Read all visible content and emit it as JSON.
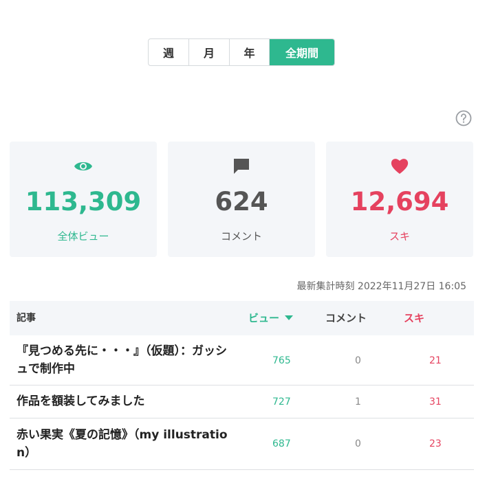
{
  "tabs": [
    {
      "label": "週",
      "active": false
    },
    {
      "label": "月",
      "active": false
    },
    {
      "label": "年",
      "active": false
    },
    {
      "label": "全期間",
      "active": true
    }
  ],
  "stats": {
    "views": {
      "value": "113,309",
      "label": "全体ビュー",
      "icon": "eye-icon"
    },
    "comments": {
      "value": "624",
      "label": "コメント",
      "icon": "comment-icon"
    },
    "likes": {
      "value": "12,694",
      "label": "スキ",
      "icon": "heart-icon"
    }
  },
  "updated": "最新集計時刻 2022年11月27日 16:05",
  "table": {
    "headers": {
      "article": "記事",
      "views": "ビュー",
      "comments": "コメント",
      "likes": "スキ"
    },
    "rows": [
      {
        "title": "『見つめる先に・・・』（仮題）：ガッシュで制作中",
        "views": "765",
        "comments": "0",
        "likes": "21"
      },
      {
        "title": "作品を額装してみました",
        "views": "727",
        "comments": "1",
        "likes": "31"
      },
      {
        "title": "赤い果実《夏の記憶》（my illustration）",
        "views": "687",
        "comments": "0",
        "likes": "23"
      }
    ]
  },
  "colors": {
    "accent": "#2eb88f",
    "like": "#e5425f",
    "card_bg": "#f4f6f9"
  }
}
